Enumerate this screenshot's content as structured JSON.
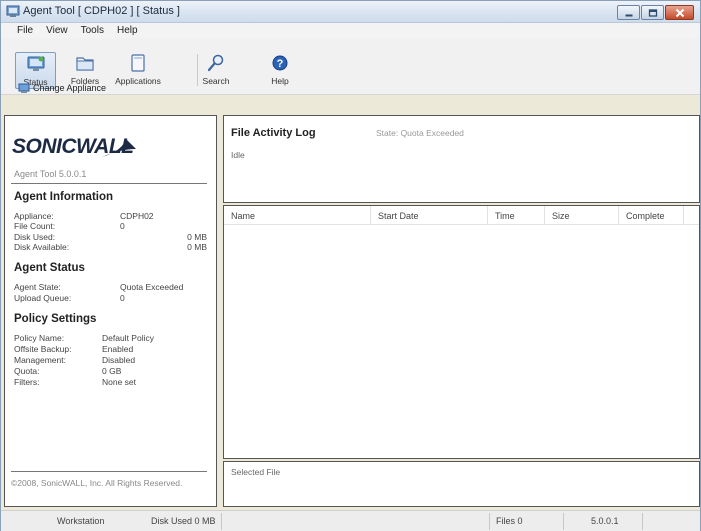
{
  "window": {
    "title": "Agent Tool [ CDPH02 ] [ Status ]",
    "controls": {
      "minimize": "minimize-icon",
      "maximize": "maximize-icon",
      "close": "close-icon"
    }
  },
  "menu": {
    "items": [
      "File",
      "View",
      "Tools",
      "Help"
    ]
  },
  "toolbar": {
    "buttons": [
      {
        "label": "Status",
        "icon": "status-icon",
        "active": true
      },
      {
        "label": "Folders",
        "icon": "folder-icon",
        "active": false
      },
      {
        "label": "Applications",
        "icon": "applications-icon",
        "active": false
      },
      {
        "label": "Search",
        "icon": "search-icon",
        "active": false
      },
      {
        "label": "Help",
        "icon": "help-icon",
        "active": false
      }
    ],
    "change_appliance": "Change Appliance"
  },
  "left_panel": {
    "logo_text": "SONICWALL",
    "version": "Agent Tool 5.0.0.1",
    "agent_information": {
      "title": "Agent Information",
      "rows": [
        {
          "key": "Appliance:",
          "value": "CDPH02"
        },
        {
          "key": "File Count:",
          "value": "0"
        },
        {
          "key": "Disk Used:",
          "value": "0 MB"
        },
        {
          "key": "Disk Available:",
          "value": "0 MB"
        }
      ]
    },
    "agent_status": {
      "title": "Agent Status",
      "rows": [
        {
          "key": "Agent State:",
          "value": "Quota Exceeded"
        },
        {
          "key": "Upload Queue:",
          "value": "0"
        }
      ]
    },
    "policy_settings": {
      "title": "Policy Settings",
      "rows": [
        {
          "key": "Policy Name:",
          "value": "Default Policy"
        },
        {
          "key": "Offsite Backup:",
          "value": "Enabled"
        },
        {
          "key": "Management:",
          "value": "Disabled"
        },
        {
          "key": "Quota:",
          "value": "0 GB"
        },
        {
          "key": "Filters:",
          "value": "None set"
        }
      ]
    },
    "copyright": "©2008, SonicWALL, Inc. All Rights Reserved."
  },
  "activity": {
    "title": "File Activity Log",
    "status": "State: Quota Exceeded",
    "message": "Idle"
  },
  "file_list": {
    "columns": [
      "Name",
      "Start Date",
      "Time",
      "Size",
      "Complete"
    ],
    "rows": []
  },
  "selected_file": {
    "label": "Selected File"
  },
  "statusbar": {
    "workstation": "Workstation",
    "disk_used": "Disk Used 0 MB",
    "files": "Files 0",
    "version": "5.0.0.1"
  }
}
